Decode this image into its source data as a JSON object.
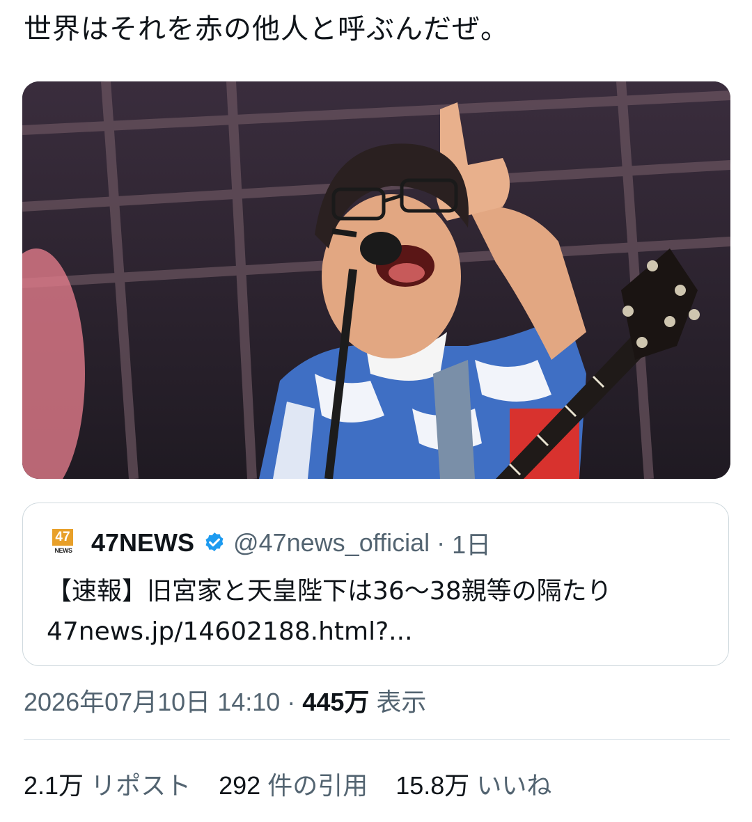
{
  "tweet": {
    "text": "世界はそれを赤の他人と呼ぶんだぜ。"
  },
  "quote": {
    "logo_number": "47",
    "logo_label": "NEWS",
    "name": "47NEWS",
    "handle": "@47news_official",
    "time": "1日",
    "text_line1": "【速報】旧宮家と天皇陛下は36〜38親等の隔たり",
    "text_line2": "47news.jp/14602188.html?..."
  },
  "meta": {
    "timestamp": "2026年07月10日 14:10",
    "separator": "·",
    "views_count": "445万",
    "views_label": "表示"
  },
  "stats": {
    "reposts_count": "2.1万",
    "reposts_label": "リポスト",
    "quotes_count": "292",
    "quotes_label": "件の引用",
    "likes_count": "15.8万",
    "likes_label": "いいね"
  },
  "colors": {
    "verified": "#1d9bf0",
    "secondary_text": "#536471",
    "logo": "#e8a02a"
  }
}
